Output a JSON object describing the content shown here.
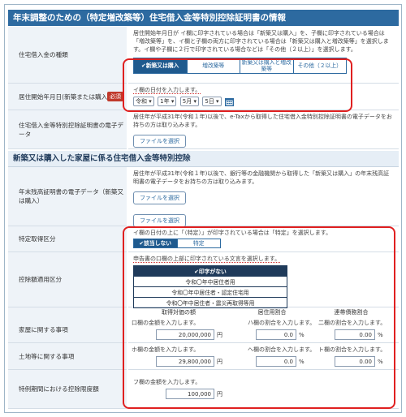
{
  "section1": {
    "title": "年末調整のための（特定増改築等）住宅借入金等特別控除証明書の情報",
    "loan_type": {
      "label": "住宅借入金の種類",
      "desc": "居住開始年月日が イ欄に印字されている場合は「新築又は購入」を、子欄に印字されている場合は「増改築等」を、イ欄と子欄の両方に印字されている場合は「新築又は購入と増改築等」を選択します。イ欄や子欄に２行で印字されている場合などは「その他（２以上）」を選択します。",
      "options": [
        "✔新築又は購入",
        "増改築等",
        "新築又は購入と増改築等",
        "その他（２以上）"
      ],
      "selected_index": 0
    },
    "move_in": {
      "label": "居住開始年月日(新築または購入)",
      "required": "必須",
      "hint": "イ欄の日付を入力します。",
      "era": "令和",
      "year": "1年",
      "month": "5月",
      "day": "5日"
    },
    "certificate": {
      "label": "住宅借入金等特別控除証明書の電子データ",
      "desc": "居住年が平成31年(令和１年)以後で、e-Taxから取得した住宅借入金特別控除証明書の電子データをお持ちの方は取り込みます。",
      "button": "ファイルを選択"
    }
  },
  "section2": {
    "title": "新築又は購入した家屋に係る住宅借入金等特別控除",
    "balance_cert": {
      "label": "年末残高証明書の電子データ（新築又は購入）",
      "desc": "居住年が平成31年(令和１年)以後で、銀行等の金融機関から取得した「新築又は購入」の年末残高証明書の電子データをお持ちの方は取り込みます。",
      "button1": "ファイルを選択",
      "button2": "ファイルを選択"
    },
    "special": {
      "label": "特定取得区分",
      "hint": "イ欄の日付の上に「（特定）」が印字されている場合は「特定」を選択します。",
      "options": [
        "✔該当しない",
        "特定"
      ],
      "selected_index": 0
    },
    "deduction": {
      "label": "控除額適用区分",
      "hint": "申告書の口欄の上部に印字されている文言を選択します。",
      "options": [
        "✔印字がない",
        "令和〇年中居住者用",
        "令和〇年中居住者・認定住宅用",
        "令和〇年中居住者・震災再取得等用"
      ],
      "selected_index": 0
    },
    "grid": {
      "col1": "取得対価の額",
      "col2": "居住用割合",
      "col3": "連帯債務割合",
      "house": {
        "label": "家屋に関する事項",
        "h1": "口欄の金額を入力します。",
        "v1": "20,000,000",
        "u1": "円",
        "h2": "ハ欄の割合を入力します。",
        "v2": "0.0",
        "u2": "%",
        "h3": "二欄の割合を入力します。",
        "v3": "0.00",
        "u3": "%"
      },
      "land": {
        "label": "土地等に関する事項",
        "h1": "ホ欄の金額を入力します。",
        "v1": "29,800,000",
        "u1": "円",
        "h2": "へ欄の割合を入力します。",
        "v2": "0.0",
        "u2": "%",
        "h3": "ト欄の割合を入力します。",
        "v3": "0.00",
        "u3": "%"
      }
    },
    "limit": {
      "label": "特例期間における控除限度額",
      "hint": "フ欄の金額を入力します。",
      "value": "100,000",
      "unit": "円"
    }
  }
}
